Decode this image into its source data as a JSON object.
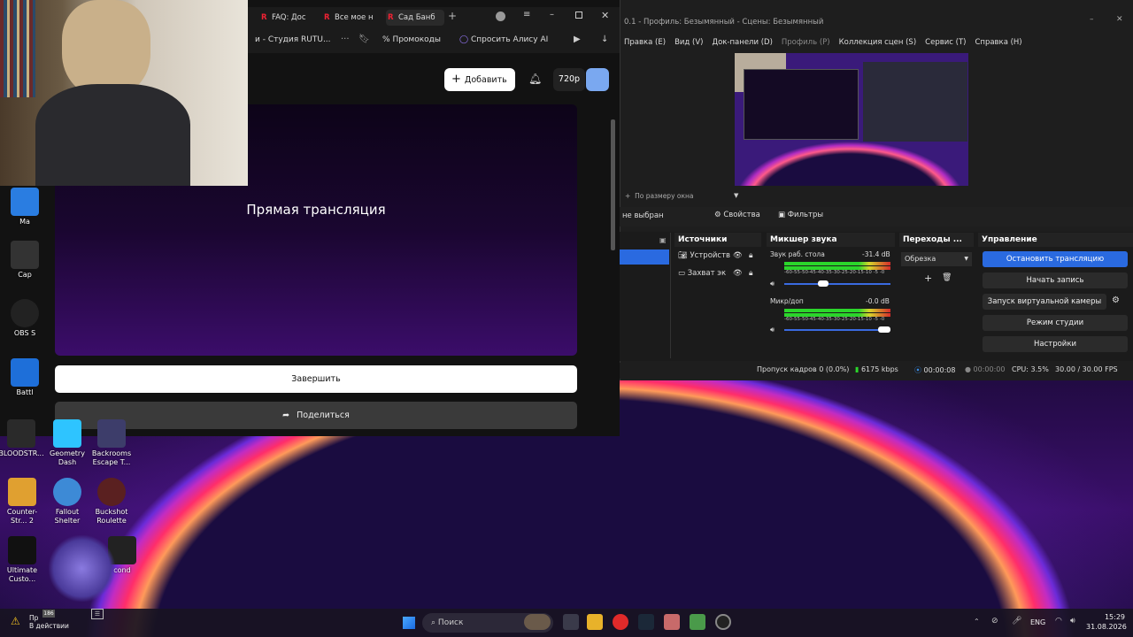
{
  "browser": {
    "tabs": [
      "FAQ: Дос",
      "Все мое н",
      "Сад Банб"
    ],
    "address_bar": "и - Студия RUTU...",
    "bookmarks": [
      "Промокоды",
      "Спросить Алису AI"
    ],
    "toolbar": {
      "add_label": "Добавить",
      "quality_label": "720p"
    },
    "player": {
      "title": "Прямая трансляция"
    },
    "buttons": {
      "finish": "Завершить",
      "share": "Поделиться"
    }
  },
  "obs": {
    "title": "0.1 - Профиль: Безымянный - Сцены: Безымянный",
    "menu": [
      "Правка (E)",
      "Вид (V)",
      "Док-панели (D)",
      "Профиль (P)",
      "Коллекция сцен (S)",
      "Сервис (T)",
      "Справка (H)"
    ],
    "zoom_label": "По размеру окна",
    "source_bar": {
      "not_selected": "не выбран",
      "properties": "Свойства",
      "filters": "Фильтры"
    },
    "docks": {
      "sources": "Источники",
      "mixer": "Микшер звука",
      "transitions": "Переходы ...",
      "controls": "Управление"
    },
    "sources": [
      "Устройств",
      "Захват эк"
    ],
    "mixer": [
      {
        "name": "Звук раб. стола",
        "db": "-31.4 dB",
        "scale": "-60-55-50-45-40-35-30-25-20-15-10 -5 -0"
      },
      {
        "name": "Микр/доп",
        "db": "-0.0 dB",
        "scale": "-60-55-50-45-40-35-30-25-20-15-10 -5 -0"
      }
    ],
    "transition": "Обрезка",
    "controls": [
      "Остановить трансляцию",
      "Начать запись",
      "Запуск виртуальной камеры",
      "Режим студии",
      "Настройки"
    ],
    "status": {
      "dropped": "Пропуск кадров 0 (0.0%)",
      "bitrate": "6175 kbps",
      "stream_time": "00:00:08",
      "rec_time": "00:00:00",
      "cpu": "CPU: 3.5%",
      "fps": "30.00 / 30.00 FPS"
    }
  },
  "desktop_icons": [
    {
      "label": "Ma",
      "color": "#2a7de1"
    },
    {
      "label": "Cap",
      "color": "#333"
    },
    {
      "label": "OBS S",
      "color": "#222"
    },
    {
      "label": "Battl",
      "color": "#1e6fd9"
    },
    {
      "label": "BLOODSTR...",
      "color": "#2a2a2a"
    },
    {
      "label": "Geometry Dash",
      "color": "#2ec4ff"
    },
    {
      "label": "Backrooms Escape T...",
      "color": "#3d3d6a"
    },
    {
      "label": "Counter-Str... 2",
      "color": "#e0a030"
    },
    {
      "label": "Fallout Shelter",
      "color": "#3d8ad6"
    },
    {
      "label": "Buckshot Roulette",
      "color": "#5a2020"
    },
    {
      "label": "Ultimate Custo...",
      "color": "#111"
    },
    {
      "label": "cond",
      "color": "#222"
    }
  ],
  "taskbar": {
    "search": "Поиск",
    "notification": "Пр",
    "notification_sub": "В действии",
    "badge": "186",
    "lang": "ENG",
    "time": "15:29",
    "date": "31.08.2026"
  }
}
